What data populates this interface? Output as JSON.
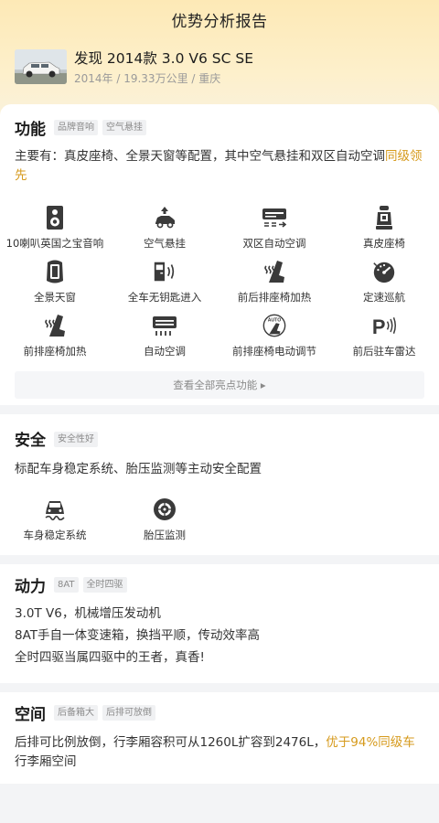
{
  "page": {
    "title": "优势分析报告"
  },
  "car": {
    "name": "发现 2014款 3.0 V6 SC SE",
    "meta": "2014年 / 19.33万公里 / 重庆"
  },
  "colors": {
    "highlight": "#d69a1c",
    "accent_bg": "#fde9b6"
  },
  "function": {
    "title": "功能",
    "tags": [
      "品牌音响",
      "空气悬挂"
    ],
    "desc_main": "主要有：真皮座椅、全景天窗等配置，其中空气悬挂和双区自动空调",
    "desc_highlight": "同级领先",
    "features": [
      {
        "label": "10喇叭英国之宝音响",
        "icon": "speaker-icon"
      },
      {
        "label": "空气悬挂",
        "icon": "air-suspension-icon"
      },
      {
        "label": "双区自动空调",
        "icon": "dual-zone-ac-icon"
      },
      {
        "label": "真皮座椅",
        "icon": "leather-seat-icon"
      },
      {
        "label": "全景天窗",
        "icon": "panoramic-sunroof-icon"
      },
      {
        "label": "全车无钥匙进入",
        "icon": "keyless-entry-icon"
      },
      {
        "label": "前后排座椅加热",
        "icon": "seat-heating-icon"
      },
      {
        "label": "定速巡航",
        "icon": "cruise-control-icon"
      },
      {
        "label": "前排座椅加热",
        "icon": "front-seat-heating-icon"
      },
      {
        "label": "自动空调",
        "icon": "auto-ac-icon"
      },
      {
        "label": "前排座椅电动调节",
        "icon": "power-seat-icon"
      },
      {
        "label": "前后驻车雷达",
        "icon": "parking-radar-icon"
      }
    ],
    "view_all": "查看全部亮点功能 ▸"
  },
  "safety": {
    "title": "安全",
    "tags": [
      "安全性好"
    ],
    "desc": "标配车身稳定系统、胎压监测等主动安全配置",
    "features": [
      {
        "label": "车身稳定系统",
        "icon": "stability-control-icon"
      },
      {
        "label": "胎压监测",
        "icon": "tire-pressure-icon"
      }
    ]
  },
  "power": {
    "title": "动力",
    "tags": [
      "8AT",
      "全时四驱"
    ],
    "lines": [
      "3.0T V6，机械增压发动机",
      "8AT手自一体变速箱，换挡平顺，传动效率高",
      "全时四驱当属四驱中的王者，真香!"
    ]
  },
  "space": {
    "title": "空间",
    "tags": [
      "后备箱大",
      "后排可放倒"
    ],
    "desc_main": "后排可比例放倒，行李厢容积可从1260L扩容到2476L，",
    "desc_highlight": "优于94%同级车",
    "desc_tail": "行李厢空间"
  }
}
